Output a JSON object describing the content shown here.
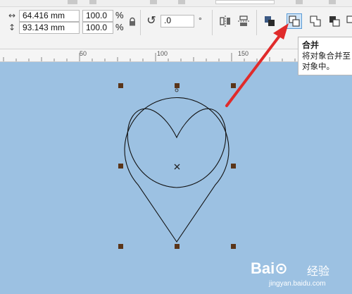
{
  "colors": {
    "canvas": "#9cc1e2",
    "handle": "#5a3519",
    "arrow": "#e02b2b",
    "active_button": "#cfe4f7"
  },
  "property_bar": {
    "width_value": "64.416 mm",
    "height_value": "93.143 mm",
    "scale_x": "100.0",
    "scale_y": "100.0",
    "percent_symbol": "%",
    "rotation_value": ".0",
    "degree_symbol": "°"
  },
  "icons": {
    "width": "width-icon",
    "height": "height-icon",
    "lock": "lock-icon",
    "rotation": "rotation-icon",
    "mirror_h": "mirror-horizontal-icon",
    "mirror_v": "mirror-vertical-icon",
    "to_front": "arrange-icon",
    "combine": "combine-icon",
    "weld": "weld-icon",
    "trim": "trim-icon"
  },
  "tooltip": {
    "title": "合并",
    "line1": "将对象合并至",
    "line2": "对象中。"
  },
  "ruler": {
    "labels": [
      "50",
      "100",
      "150"
    ]
  },
  "watermark": {
    "logo": "Bai⊙",
    "chinese": "经验",
    "url": "jingyan.baidu.com"
  }
}
